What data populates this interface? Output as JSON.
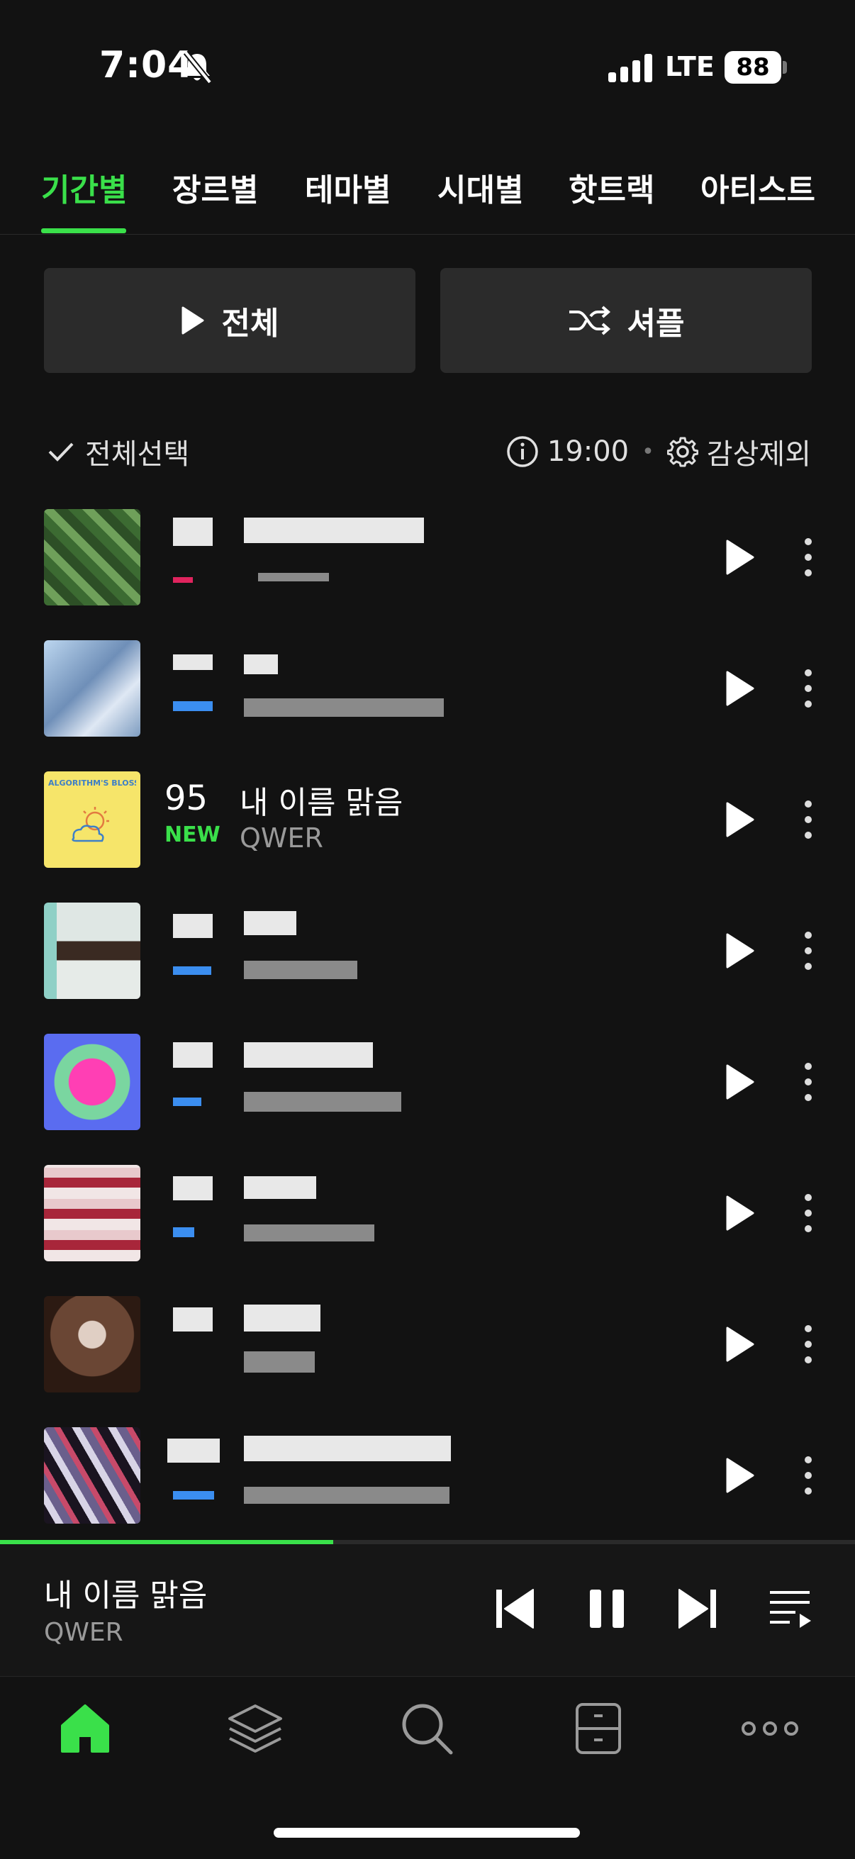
{
  "status": {
    "time": "7:04",
    "network": "LTE",
    "battery": "88"
  },
  "tabs": [
    {
      "label": "기간별",
      "active": true
    },
    {
      "label": "장르별",
      "active": false
    },
    {
      "label": "테마별",
      "active": false
    },
    {
      "label": "시대별",
      "active": false
    },
    {
      "label": "핫트랙",
      "active": false
    },
    {
      "label": "아티스트",
      "active": false
    }
  ],
  "actions": {
    "play_all": "전체",
    "shuffle": "셔플"
  },
  "select": {
    "select_all": "전체선택",
    "time": "19:00",
    "exclude": "감상제외"
  },
  "tracks": [
    {
      "rank": "",
      "badge": "",
      "title": "",
      "artist": ""
    },
    {
      "rank": "",
      "badge": "",
      "title": "",
      "artist": ""
    },
    {
      "rank": "95",
      "badge": "NEW",
      "title": "내 이름 맑음",
      "artist": "QWER",
      "art_text": "ALGORITHM'S BLOSSOM"
    },
    {
      "rank": "",
      "badge": "",
      "title": "",
      "artist": ""
    },
    {
      "rank": "",
      "badge": "",
      "title": "",
      "artist": ""
    },
    {
      "rank": "",
      "badge": "",
      "title": "",
      "artist": ""
    },
    {
      "rank": "",
      "badge": "",
      "title": "",
      "artist": ""
    },
    {
      "rank": "",
      "badge": "",
      "title": "",
      "artist": ""
    }
  ],
  "now_playing": {
    "title": "내 이름 맑음",
    "artist": "QWER",
    "progress": 0.39
  },
  "nav": [
    "home-icon",
    "layers-icon",
    "search-icon",
    "library-icon",
    "more-icon"
  ],
  "colors": {
    "accent": "#3ae04a",
    "background": "#121212",
    "button": "#2b2b2b"
  }
}
